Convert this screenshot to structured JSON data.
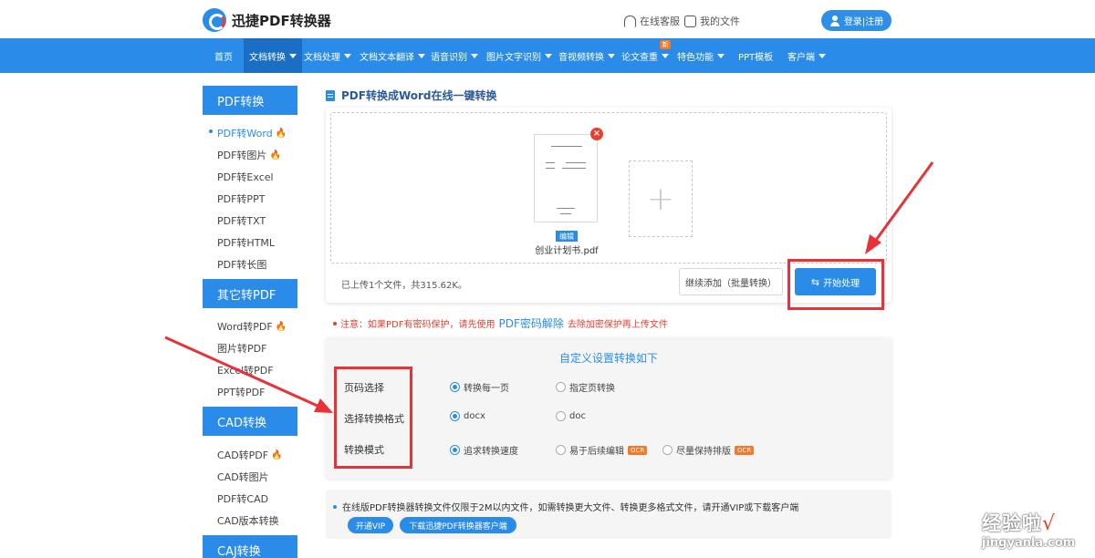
{
  "header": {
    "app_name": "迅捷PDF转换器",
    "online_service": "在线客服",
    "my_files": "我的文件",
    "login": "登录|注册"
  },
  "nav": {
    "items": [
      {
        "label": "首页",
        "caret": false
      },
      {
        "label": "文档转换",
        "caret": true,
        "active": true
      },
      {
        "label": "文档处理",
        "caret": true
      },
      {
        "label": "文档文本翻译",
        "caret": true
      },
      {
        "label": "语音识别",
        "caret": true
      },
      {
        "label": "图片文字识别",
        "caret": true
      },
      {
        "label": "音视频转换",
        "caret": true
      },
      {
        "label": "论文查重",
        "caret": true
      },
      {
        "label": "特色功能",
        "caret": true
      },
      {
        "label": "PPT模板",
        "caret": false
      },
      {
        "label": "客户端",
        "caret": true
      }
    ],
    "new_badge": "新"
  },
  "sidebar": {
    "sections": [
      {
        "title": "PDF转换",
        "items": [
          {
            "label": "PDF转Word",
            "hot": true,
            "active": true
          },
          {
            "label": "PDF转图片",
            "hot": true
          },
          {
            "label": "PDF转Excel",
            "hot": false
          },
          {
            "label": "PDF转PPT",
            "hot": false
          },
          {
            "label": "PDF转TXT",
            "hot": false
          },
          {
            "label": "PDF转HTML",
            "hot": false
          },
          {
            "label": "PDF转长图",
            "hot": false
          }
        ]
      },
      {
        "title": "其它转PDF",
        "items": [
          {
            "label": "Word转PDF",
            "hot": true
          },
          {
            "label": "图片转PDF",
            "hot": false
          },
          {
            "label": "Excel转PDF",
            "hot": false
          },
          {
            "label": "PPT转PDF",
            "hot": false
          }
        ]
      },
      {
        "title": "CAD转换",
        "items": [
          {
            "label": "CAD转PDF",
            "hot": true
          },
          {
            "label": "CAD转图片",
            "hot": false
          },
          {
            "label": "PDF转CAD",
            "hot": false
          },
          {
            "label": "CAD版本转换",
            "hot": false
          }
        ]
      },
      {
        "title": "CAJ转换",
        "items": []
      }
    ]
  },
  "main": {
    "title": "PDF转换成Word在线一键转换",
    "file": {
      "name": "创业计划书.pdf",
      "edit": "编辑"
    },
    "upload_status": "已上传1个文件，共315.62K。",
    "add_more": "继续添加（批量转换）",
    "start": "开始处理",
    "notice_prefix": "注意：如果PDF有密码保护，请先使用",
    "notice_link": "PDF密码解除",
    "notice_suffix": "去除加密保护再上传文件"
  },
  "settings": {
    "title": "自定义设置转换如下",
    "rows": [
      {
        "label": "页码选择",
        "options": [
          {
            "label": "转换每一页",
            "selected": true
          },
          {
            "label": "指定页转换",
            "selected": false
          }
        ]
      },
      {
        "label": "选择转换格式",
        "options": [
          {
            "label": "docx",
            "selected": true
          },
          {
            "label": "doc",
            "selected": false
          }
        ]
      },
      {
        "label": "转换模式",
        "options": [
          {
            "label": "追求转换速度",
            "selected": true
          },
          {
            "label": "易于后续编辑",
            "selected": false,
            "badge": "OCR"
          },
          {
            "label": "尽量保持排版",
            "selected": false,
            "badge": "OCR"
          }
        ]
      }
    ]
  },
  "info": {
    "text": "在线版PDF转换器转换文件仅限于2M以内文件，如需转换更大文件、转换更多格式文件，请开通VIP或下载客户端",
    "vip": "开通VIP",
    "download": "下载迅捷PDF转换器客户端"
  },
  "watermark": {
    "title": "经验啦",
    "url": "jingyanla.com"
  },
  "colors": {
    "primary": "#2a8ce8",
    "nav_active": "#1a6fc4",
    "warning": "#e8402f",
    "badge": "#f07a2a"
  }
}
